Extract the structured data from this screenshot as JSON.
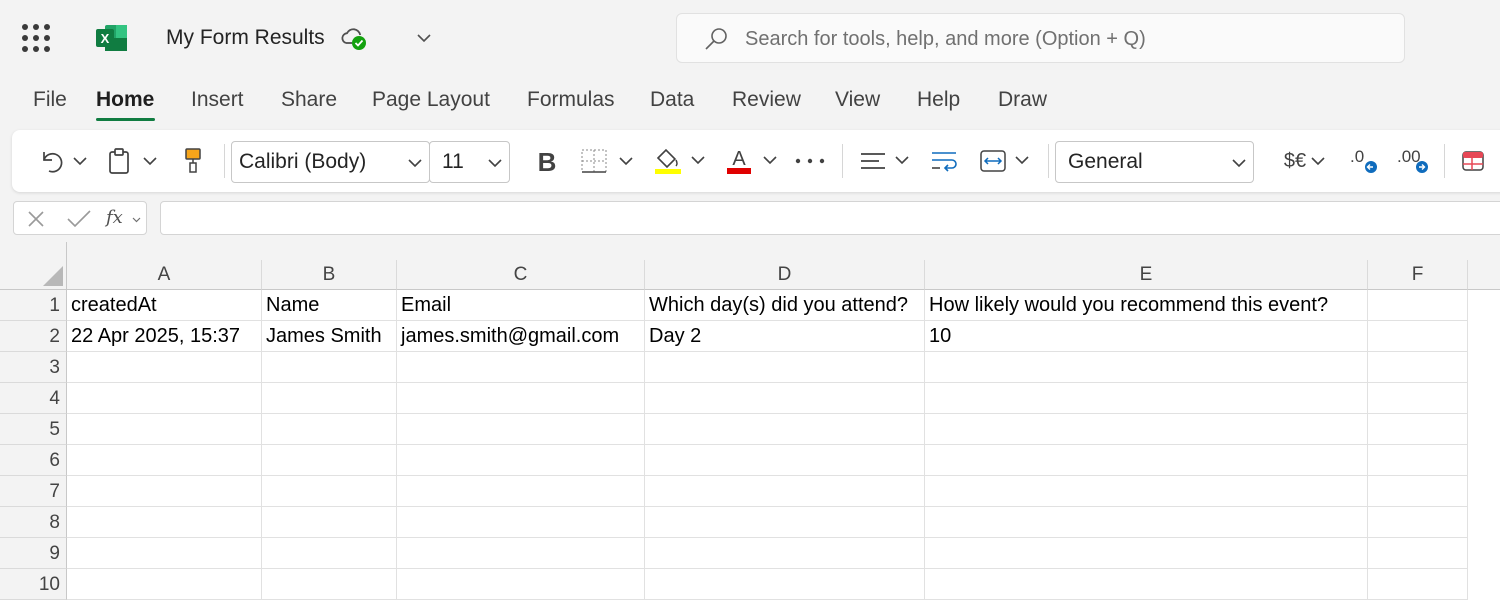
{
  "app": {
    "logo_letter": "X",
    "doc_title": "My Form Results",
    "brand_color": "#107c41",
    "search_placeholder": "Search for tools, help, and more (Option + Q)"
  },
  "menu": {
    "items": [
      "File",
      "Home",
      "Insert",
      "Share",
      "Page Layout",
      "Formulas",
      "Data",
      "Review",
      "View",
      "Help",
      "Draw"
    ],
    "active": "Home"
  },
  "ribbon": {
    "font_name": "Calibri (Body)",
    "font_size": "11",
    "number_format": "General",
    "currency_label": "$€",
    "highlight_color": "#ffff00",
    "font_color": "#e00000"
  },
  "formula_bar": {
    "fx_label": "fx",
    "value": ""
  },
  "sheet": {
    "columns": [
      "A",
      "B",
      "C",
      "D",
      "E",
      "F"
    ],
    "row_numbers": [
      "1",
      "2",
      "3",
      "4",
      "5",
      "6",
      "7",
      "8",
      "9",
      "10"
    ],
    "rows": [
      [
        "createdAt",
        "Name",
        "Email",
        "Which day(s) did you attend?",
        "How likely would you recommend this event?",
        ""
      ],
      [
        "22 Apr 2025, 15:37",
        "James Smith",
        "james.smith@gmail.com",
        "Day 2",
        "10",
        ""
      ],
      [
        "",
        "",
        "",
        "",
        "",
        ""
      ],
      [
        "",
        "",
        "",
        "",
        "",
        ""
      ],
      [
        "",
        "",
        "",
        "",
        "",
        ""
      ],
      [
        "",
        "",
        "",
        "",
        "",
        ""
      ],
      [
        "",
        "",
        "",
        "",
        "",
        ""
      ],
      [
        "",
        "",
        "",
        "",
        "",
        ""
      ],
      [
        "",
        "",
        "",
        "",
        "",
        ""
      ],
      [
        "",
        "",
        "",
        "",
        "",
        ""
      ]
    ]
  }
}
